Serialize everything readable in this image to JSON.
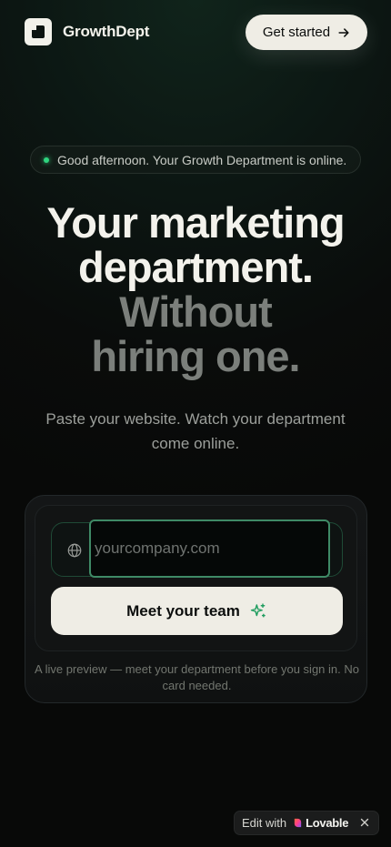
{
  "header": {
    "brand": "GrowthDept",
    "cta_label": "Get started"
  },
  "status": {
    "text": "Good afternoon. Your Growth Department is online."
  },
  "hero": {
    "line1": "Your marketing",
    "line2": "department.",
    "line3": "Without",
    "line4": "hiring one.",
    "subtitle": "Paste your website. Watch your department come online."
  },
  "form": {
    "url_placeholder": "yourcompany.com",
    "url_value": "",
    "submit_label": "Meet your team",
    "note": "A live preview — meet your department before you sign in. No card needed."
  },
  "badge": {
    "prefix": "Edit with",
    "brand": "Lovable"
  },
  "icons": {
    "logo": "logo-mark-icon",
    "arrow": "arrow-right-icon",
    "globe": "globe-icon",
    "sparkle": "sparkle-icon",
    "close": "close-icon"
  },
  "colors": {
    "accent_green": "#2fd47f",
    "input_border": "#3f8a66",
    "button_bg": "#efede5",
    "background": "#0a0c0b"
  }
}
